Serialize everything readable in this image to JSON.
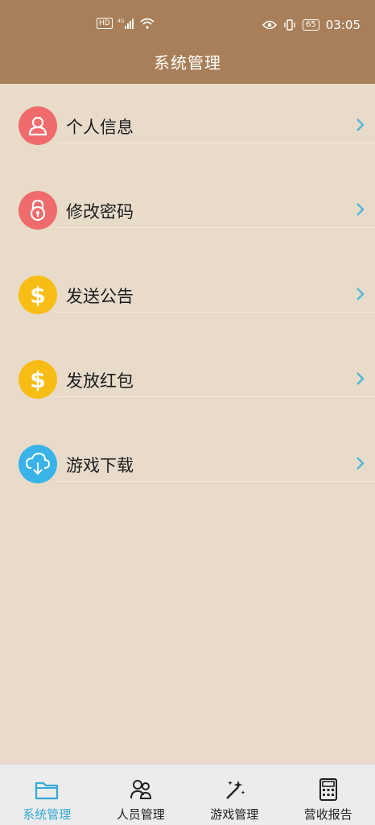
{
  "status_bar": {
    "left_icons": [
      "hd-icon",
      "signal-4g-icon",
      "wifi-icon"
    ],
    "right_icons": [
      "eye-icon",
      "vibrate-icon"
    ],
    "battery": "65",
    "time": "03:05"
  },
  "header": {
    "title": "系统管理"
  },
  "menu": [
    {
      "label": "个人信息",
      "icon": "user-icon",
      "color": "#f06b6b"
    },
    {
      "label": "修改密码",
      "icon": "lock-icon",
      "color": "#f06b6b"
    },
    {
      "label": "发送公告",
      "icon": "dollar-icon",
      "color": "#f8bd14"
    },
    {
      "label": "发放红包",
      "icon": "dollar-icon",
      "color": "#f8bd14"
    },
    {
      "label": "游戏下载",
      "icon": "cloud-download-icon",
      "color": "#3ab4e8"
    }
  ],
  "tabs": [
    {
      "label": "系统管理",
      "icon": "folder-icon",
      "active": true
    },
    {
      "label": "人员管理",
      "icon": "people-icon",
      "active": false
    },
    {
      "label": "游戏管理",
      "icon": "magic-wand-icon",
      "active": false
    },
    {
      "label": "营收报告",
      "icon": "calculator-icon",
      "active": false
    }
  ],
  "colors": {
    "header": "#a87f58",
    "background": "#e8dbca",
    "accent": "#35a9d8"
  }
}
